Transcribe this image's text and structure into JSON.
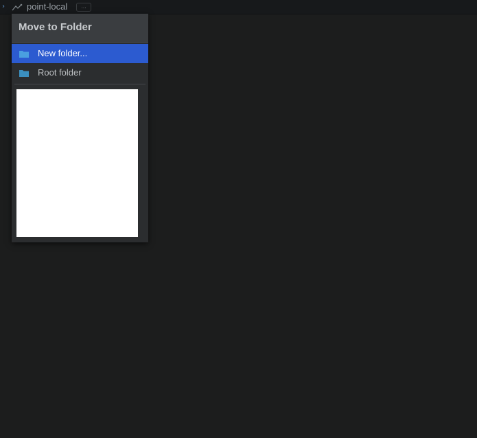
{
  "topbar": {
    "item_label": "point-local",
    "ellipsis": "...",
    "chevron": "›"
  },
  "dialog": {
    "title": "Move to Folder",
    "items": [
      {
        "label": "New folder...",
        "icon": "folder-icon",
        "selected": true
      },
      {
        "label": "Root folder",
        "icon": "folder-icon",
        "selected": false
      }
    ]
  },
  "colors": {
    "accent": "#2c5bd0",
    "background": "#1c1d1d",
    "folder": "#4a9fe0"
  }
}
